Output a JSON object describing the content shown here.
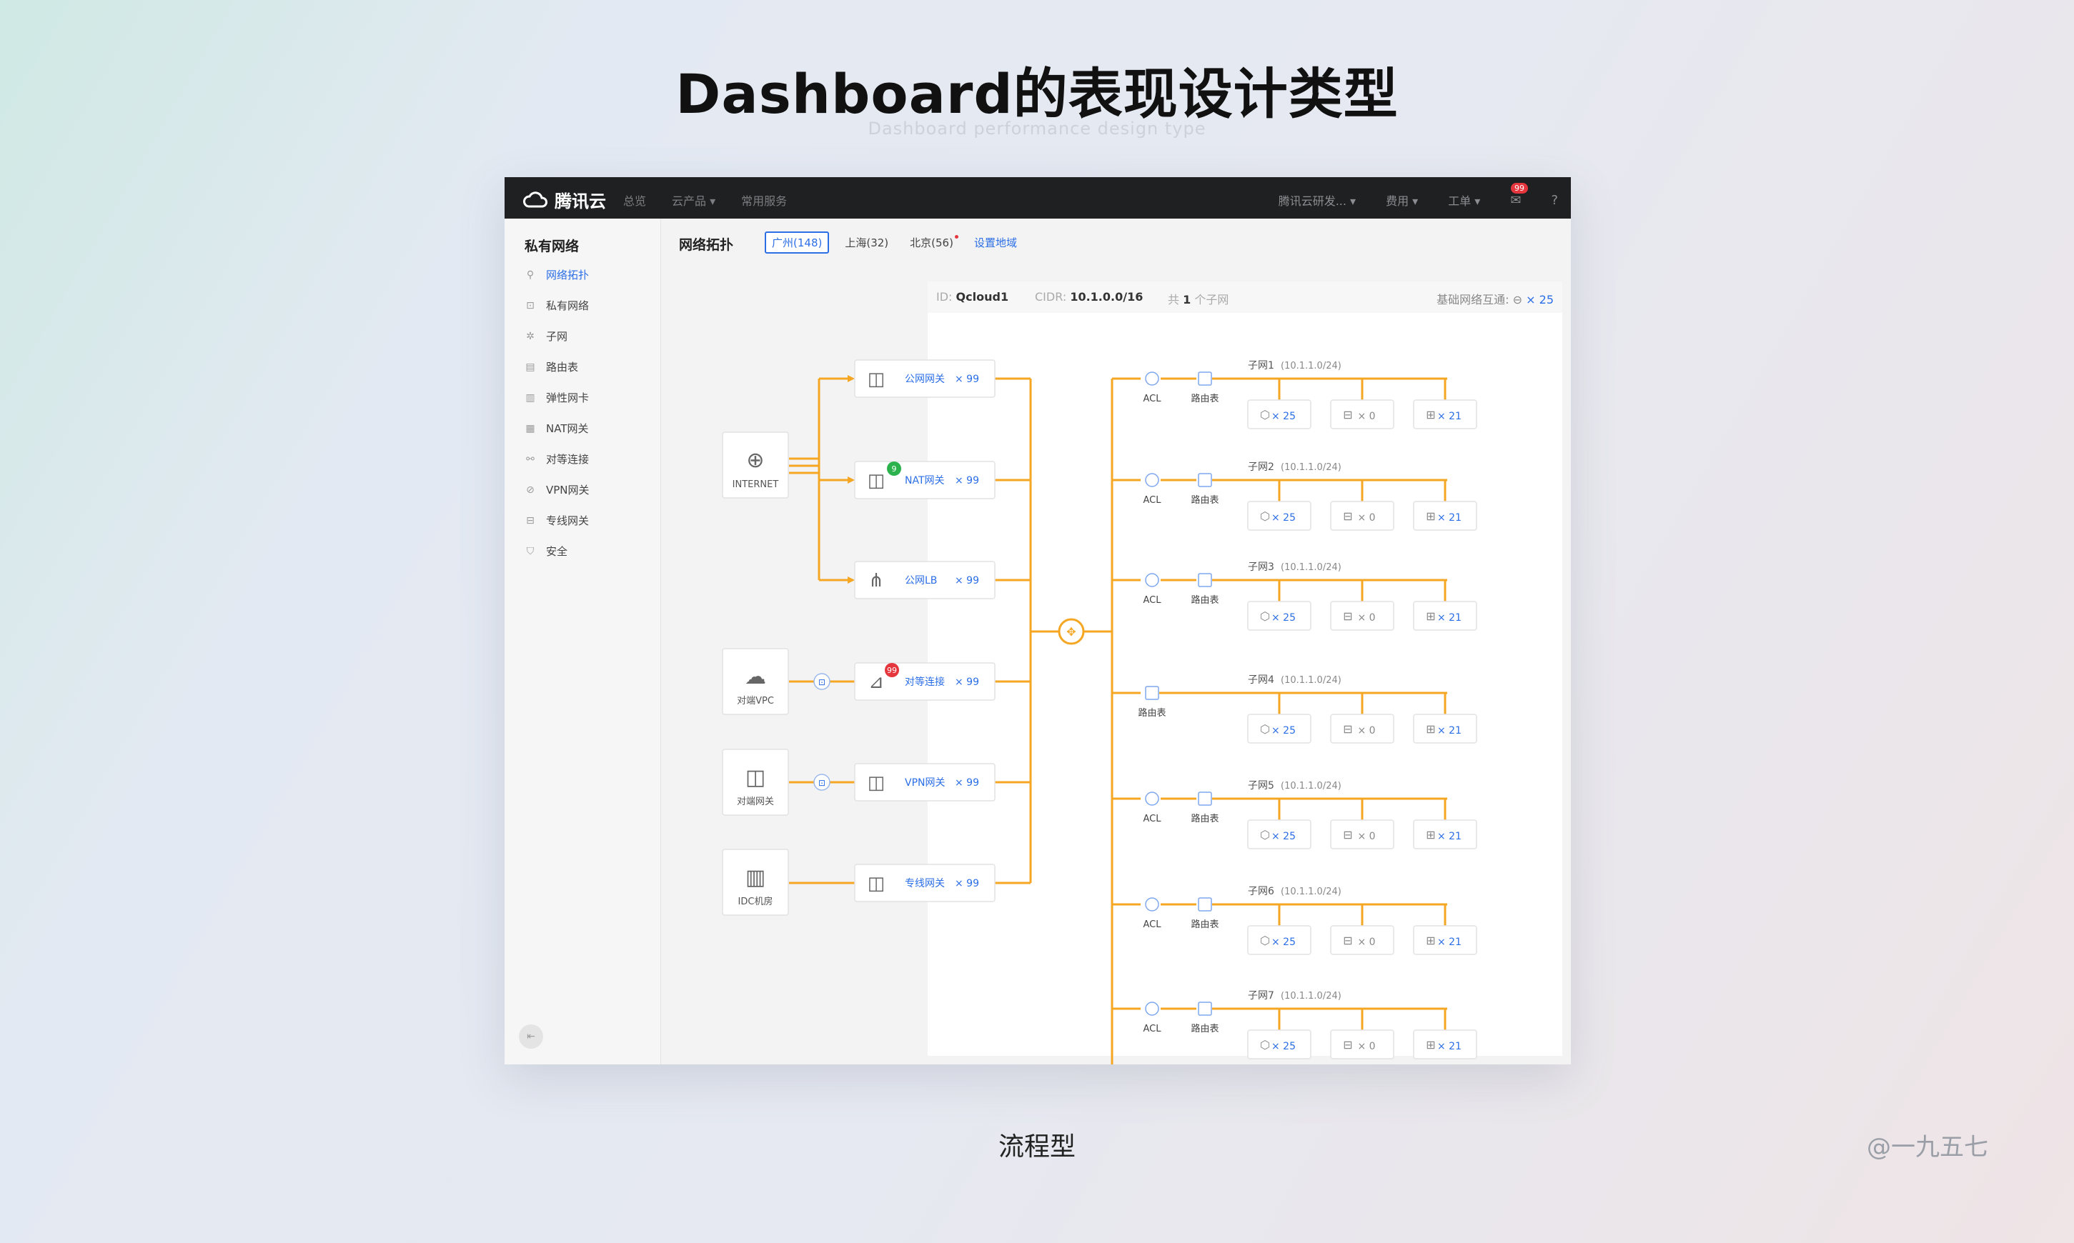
{
  "heading": {
    "title": "Dashboard的表现设计类型",
    "subtitle": "Dashboard performance design type"
  },
  "app": {
    "brand": "腾讯云",
    "nav": [
      "总览",
      "云产品 ▾",
      "常用服务"
    ],
    "right_nav": [
      "腾讯云研发... ▾",
      "费用 ▾",
      "工单 ▾"
    ],
    "message_count": "99",
    "help_icon": "question-circle-icon"
  },
  "sidebar": {
    "title": "私有网络",
    "items": [
      {
        "label": "网络拓扑",
        "icon": "topology-icon",
        "active": true
      },
      {
        "label": "私有网络",
        "icon": "lock-icon",
        "active": false
      },
      {
        "label": "子网",
        "icon": "subnet-icon",
        "active": false
      },
      {
        "label": "路由表",
        "icon": "document-icon",
        "active": false
      },
      {
        "label": "弹性网卡",
        "icon": "nic-icon",
        "active": false
      },
      {
        "label": "NAT网关",
        "icon": "nat-icon",
        "active": false
      },
      {
        "label": "对等连接",
        "icon": "peer-icon",
        "active": false
      },
      {
        "label": "VPN网关",
        "icon": "vpn-icon",
        "active": false
      },
      {
        "label": "专线网关",
        "icon": "dc-icon",
        "active": false
      },
      {
        "label": "安全",
        "icon": "shield-icon",
        "active": false
      }
    ]
  },
  "main": {
    "title": "网络拓扑",
    "regions": [
      {
        "label": "广州(148)",
        "active": true
      },
      {
        "label": "上海(32)",
        "active": false
      },
      {
        "label": "北京(56)",
        "active": false,
        "dot": true
      }
    ],
    "region_link": "设置地域",
    "info": {
      "id_label": "ID:",
      "id_value": "Qcloud1",
      "cidr_label": "CIDR:",
      "cidr_value": "10.1.0.0/16",
      "subnet_prefix": "共",
      "subnet_count": "1",
      "subnet_suffix": "个子网",
      "basic_label": "基础网络互通:",
      "basic_value": "× 25"
    }
  },
  "topology": {
    "sources": [
      {
        "label": "INTERNET",
        "icon": "globe-icon"
      },
      {
        "label": "对端VPC",
        "icon": "cloud-icon"
      },
      {
        "label": "对端网关",
        "icon": "gateway-icon"
      },
      {
        "label": "IDC机房",
        "icon": "building-icon"
      }
    ],
    "gateways": [
      {
        "label": "公网网关",
        "count": "× 99",
        "icon": "door-icon"
      },
      {
        "label": "NAT网关",
        "count": "× 99",
        "icon": "nat-gateway-icon",
        "badge": "9"
      },
      {
        "label": "公网LB",
        "count": "× 99",
        "icon": "loadbalancer-icon"
      },
      {
        "label": "对等连接",
        "count": "× 99",
        "icon": "peering-icon",
        "badge": "99"
      },
      {
        "label": "VPN网关",
        "count": "× 99",
        "icon": "vpn-gateway-icon"
      },
      {
        "label": "专线网关",
        "count": "× 99",
        "icon": "direct-connect-icon"
      }
    ],
    "acl_label": "ACL",
    "route_label": "路由表",
    "subnets": [
      {
        "name": "子网1",
        "cidr": "(10.1.1.0/24)",
        "acl": true,
        "cvm": "× 25",
        "db": "× 0",
        "lb": "× 21"
      },
      {
        "name": "子网2",
        "cidr": "(10.1.1.0/24)",
        "acl": true,
        "cvm": "× 25",
        "db": "× 0",
        "lb": "× 21"
      },
      {
        "name": "子网3",
        "cidr": "(10.1.1.0/24)",
        "acl": true,
        "cvm": "× 25",
        "db": "× 0",
        "lb": "× 21"
      },
      {
        "name": "子网4",
        "cidr": "(10.1.1.0/24)",
        "acl": false,
        "cvm": "× 25",
        "db": "× 0",
        "lb": "× 21"
      },
      {
        "name": "子网5",
        "cidr": "(10.1.1.0/24)",
        "acl": true,
        "cvm": "× 25",
        "db": "× 0",
        "lb": "× 21"
      },
      {
        "name": "子网6",
        "cidr": "(10.1.1.0/24)",
        "acl": true,
        "cvm": "× 25",
        "db": "× 0",
        "lb": "× 21"
      },
      {
        "name": "子网7",
        "cidr": "(10.1.1.0/24)",
        "acl": true,
        "cvm": "× 25",
        "db": "× 0",
        "lb": "× 21"
      }
    ],
    "colors": {
      "line": "#f5a623",
      "blue": "#2b6ee6",
      "badge_green": "#2bb24c",
      "badge_red": "#e5353d"
    }
  },
  "caption": "流程型",
  "watermark": "@一九五七"
}
